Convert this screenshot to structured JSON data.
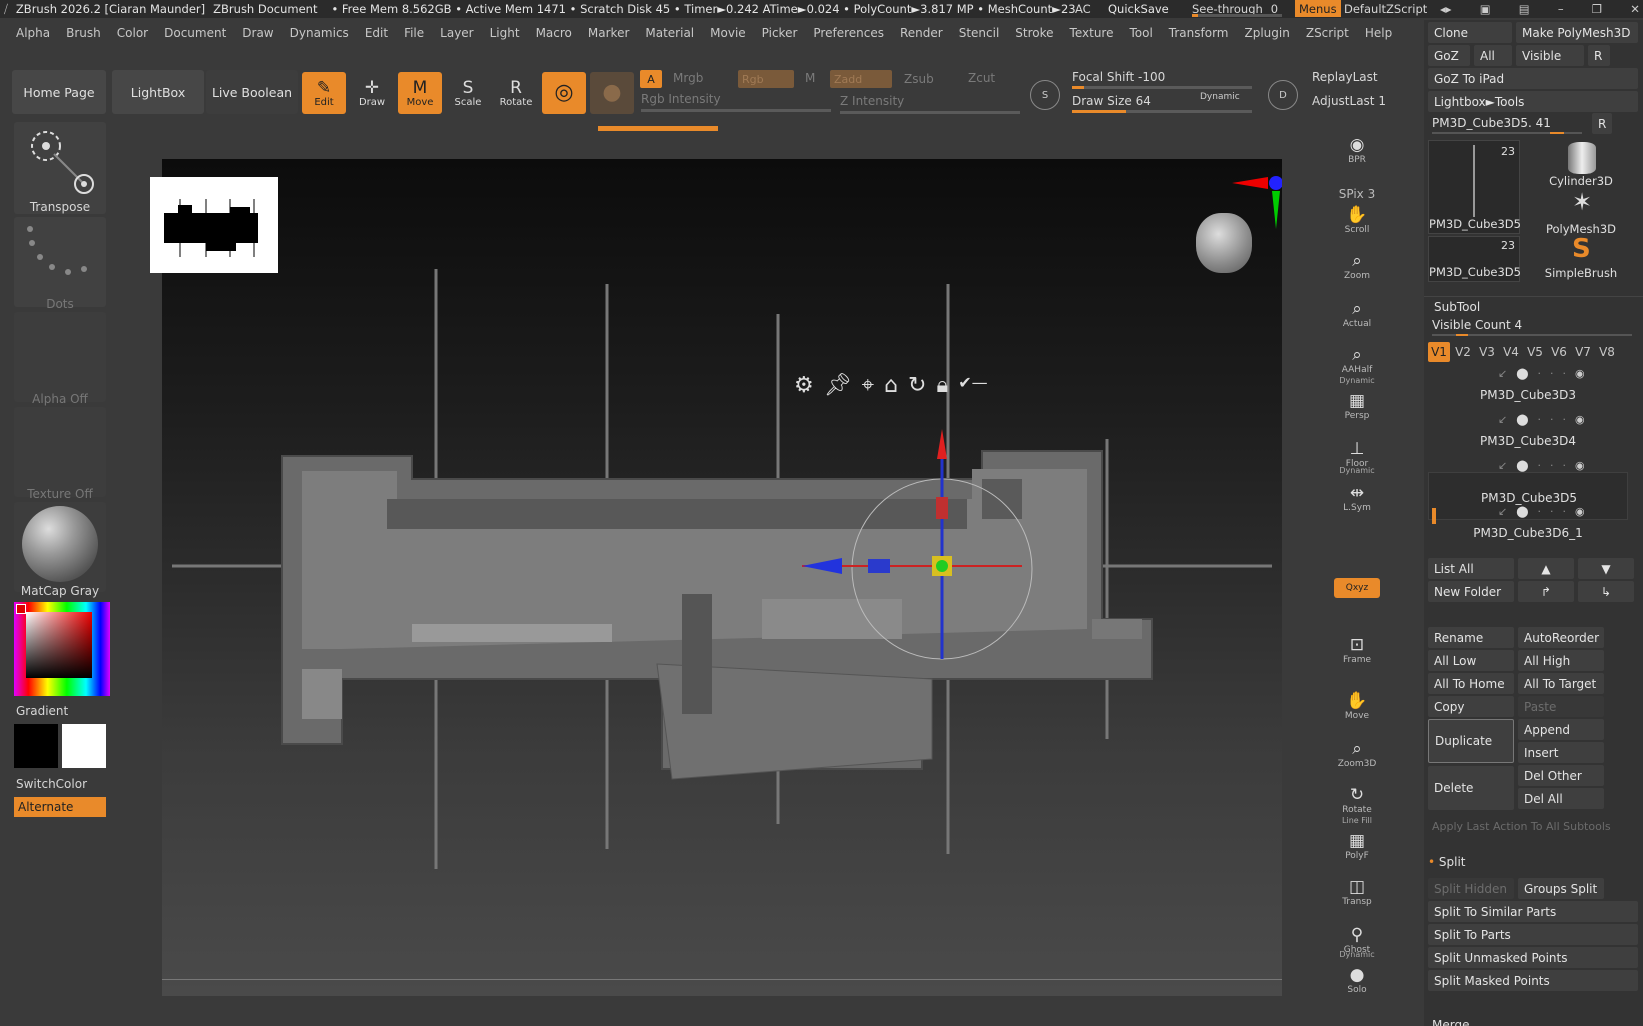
{
  "titlebar": {
    "app": "ZBrush 2026.2 [Ciaran Maunder]",
    "document": "ZBrush Document",
    "stats": "• Free Mem 8.562GB • Active Mem 1471 • Scratch Disk 45 • Timer►0.242 ATime►0.024 • PolyCount►3.817 MP • MeshCount►23",
    "ac": "AC",
    "quicksave": "QuickSave",
    "see_through_label": "See-through",
    "see_through_value": "0",
    "menus": "Menus",
    "zscript": "DefaultZScript"
  },
  "menubar": [
    "Alpha",
    "Brush",
    "Color",
    "Document",
    "Draw",
    "Dynamics",
    "Edit",
    "File",
    "Layer",
    "Light",
    "Macro",
    "Marker",
    "Material",
    "Movie",
    "Picker",
    "Preferences",
    "Render",
    "Stencil",
    "Stroke",
    "Texture",
    "Tool",
    "Transform",
    "Zplugin",
    "ZScript",
    "Help"
  ],
  "shelf": {
    "home_page": "Home Page",
    "lightbox": "LightBox",
    "live_boolean": "Live Boolean",
    "edit": "Edit",
    "draw": "Draw",
    "move": "Move",
    "scale": "Scale",
    "rotate": "Rotate",
    "a_label": "A",
    "mrgb": "Mrgb",
    "rgb": "Rgb",
    "m": "M",
    "zadd": "Zadd",
    "zsub": "Zsub",
    "zcut": "Zcut",
    "rgb_intensity": "Rgb Intensity",
    "z_intensity": "Z Intensity",
    "focal_shift": "Focal Shift -100",
    "draw_size": "Draw Size 64",
    "dynamic": "Dynamic",
    "replay_last": "ReplayLast",
    "adjust_last": "AdjustLast 1"
  },
  "lefttray": {
    "transpose": "Transpose",
    "dots": "Dots",
    "alpha_off": "Alpha Off",
    "texture_off": "Texture Off",
    "matcap": "MatCap Gray",
    "gradient": "Gradient",
    "switchcolor": "SwitchColor",
    "alternate": "Alternate"
  },
  "rightshelf": [
    {
      "name": "bpr",
      "label": "BPR"
    },
    {
      "name": "spix",
      "label": "SPix 3"
    },
    {
      "name": "scroll",
      "label": "Scroll"
    },
    {
      "name": "zoom",
      "label": "Zoom"
    },
    {
      "name": "actual",
      "label": "Actual"
    },
    {
      "name": "aahalf",
      "label": "AAHalf"
    },
    {
      "name": "persp",
      "label": "Persp"
    },
    {
      "name": "floor",
      "label": "Floor"
    },
    {
      "name": "lsym",
      "label": "L.Sym"
    },
    {
      "name": "xyz",
      "label": "Qxyz"
    },
    {
      "name": "frame",
      "label": "Frame"
    },
    {
      "name": "move",
      "label": "Move"
    },
    {
      "name": "zoom3d",
      "label": "Zoom3D"
    },
    {
      "name": "rotate",
      "label": "Rotate"
    },
    {
      "name": "polyf",
      "label": "PolyF"
    },
    {
      "name": "transp",
      "label": "Transp"
    },
    {
      "name": "ghost",
      "label": "Ghost"
    },
    {
      "name": "solo",
      "label": "Solo"
    }
  ],
  "rightshelf_extra": {
    "dynamic": "Dynamic",
    "line_fill": "Line Fill"
  },
  "rightpanel": {
    "clone": "Clone",
    "make_polymesh": "Make PolyMesh3D",
    "goz": "GoZ",
    "all": "All",
    "visible": "Visible",
    "r": "R",
    "goz_ipad": "GoZ To iPad",
    "lightbox_tools": "Lightbox►Tools",
    "current_tool": "PM3D_Cube3D5. 41",
    "thumb_count_1": "23",
    "thumb_count_2": "23",
    "thumbs": [
      "PM3D_Cube3D5",
      "Cylinder3D",
      "PolyMesh3D",
      "PM3D_Cube3D5",
      "SimpleBrush"
    ],
    "subtool_title": "SubTool",
    "visible_count": "Visible Count 4",
    "vtabs": [
      "V1",
      "V2",
      "V3",
      "V4",
      "V5",
      "V6",
      "V7",
      "V8"
    ],
    "subtools": [
      "PM3D_Cube3D3",
      "PM3D_Cube3D4",
      "PM3D_Cube3D5",
      "PM3D_Cube3D6_1"
    ],
    "list_all": "List All",
    "new_folder": "New Folder",
    "rename": "Rename",
    "autoreorder": "AutoReorder",
    "all_low": "All Low",
    "all_high": "All High",
    "all_to_home": "All To Home",
    "all_to_target": "All To Target",
    "copy": "Copy",
    "paste": "Paste",
    "duplicate": "Duplicate",
    "append": "Append",
    "insert": "Insert",
    "delete": "Delete",
    "del_other": "Del Other",
    "del_all": "Del All",
    "apply_last": "Apply Last Action To All Subtools",
    "split": "Split",
    "split_hidden": "Split Hidden",
    "groups_split": "Groups Split",
    "split_similar": "Split To Similar Parts",
    "split_parts": "Split To Parts",
    "split_unmasked": "Split Unmasked Points",
    "split_masked": "Split Masked Points",
    "merge": "Merge"
  },
  "colors": {
    "accent": "#e98a2a",
    "panel": "#333333",
    "bg": "#3a3a3a"
  }
}
